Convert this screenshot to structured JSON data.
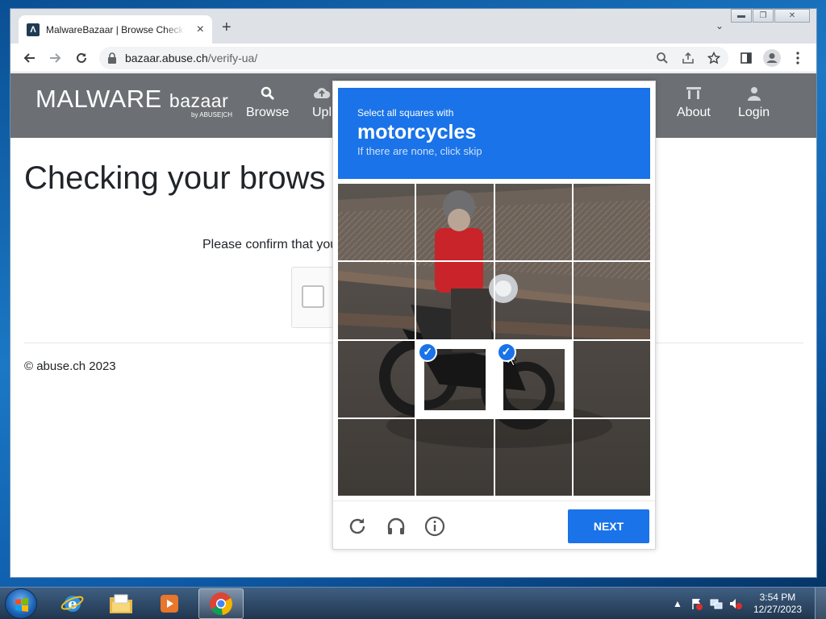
{
  "browser": {
    "tab_title": "MalwareBazaar | Browse Checking your browser",
    "tab_favicon": "Λ",
    "url_host": "bazaar.abuse.ch",
    "url_path": "/verify-ua/"
  },
  "site": {
    "logo_bold": "MALWARE",
    "logo_light": "bazaar",
    "logo_sub": "by ABUSE|CH",
    "nav": {
      "browse": "Browse",
      "upload": "Upl",
      "about": "About",
      "login": "Login"
    },
    "heading": "Checking your brows",
    "confirm_text": "Please confirm that you",
    "copyright": "© abuse.ch 2023"
  },
  "challenge": {
    "pre_text": "Select all squares with",
    "target": "motorcycles",
    "hint": "If there are none, click skip",
    "selected_tiles": [
      9,
      10
    ],
    "next_label": "NEXT",
    "accent": "#1a73e8"
  },
  "taskbar": {
    "time": "3:54 PM",
    "date": "12/27/2023"
  }
}
